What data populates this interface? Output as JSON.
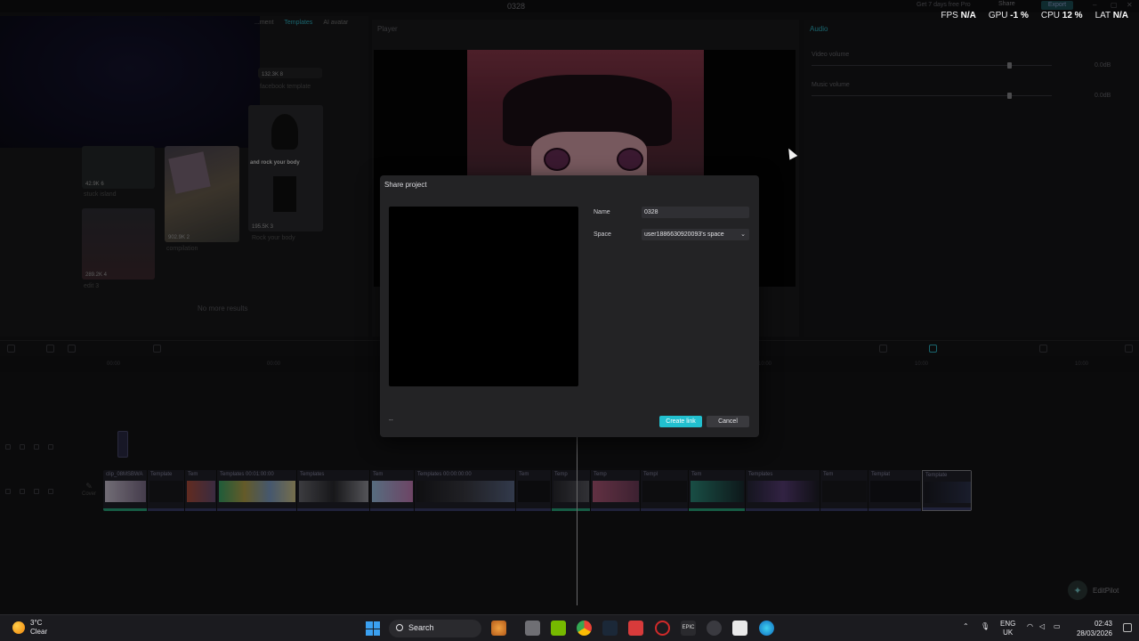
{
  "window": {
    "title": "0328",
    "promo": "Get 7 days free Pro",
    "share_label": "Share",
    "export_label": "Export"
  },
  "perf": [
    {
      "label": "FPS",
      "value": "N/A"
    },
    {
      "label": "GPU",
      "value": "-1 %"
    },
    {
      "label": "CPU",
      "value": "12 %"
    },
    {
      "label": "LAT",
      "value": "N/A"
    }
  ],
  "left_panel": {
    "tabs": [
      {
        "label": "...ment"
      },
      {
        "label": "Templates"
      },
      {
        "label": "AI avatar"
      }
    ],
    "tiles": [
      {
        "meta": "132.3K  8",
        "caption": "facebook template"
      },
      {
        "meta": "42.9K  6",
        "caption": "stuck island"
      },
      {
        "meta": "902.9K  2",
        "caption": "compilation"
      },
      {
        "meta": "195.5K  3",
        "caption": "Rock your body"
      },
      {
        "meta": "289.2K  4",
        "caption": "edit 3"
      }
    ],
    "rock_text": "and rock your body",
    "no_more": "No more results"
  },
  "player": {
    "title": "Player"
  },
  "audio": {
    "title": "Audio",
    "video_volume_label": "Video volume",
    "video_volume_value": "0.0dB",
    "music_volume_label": "Music volume",
    "music_volume_value": "0.0dB"
  },
  "timeline": {
    "ruler": [
      "00:00",
      "00:00",
      "10:00",
      "10:00",
      "10:00"
    ],
    "cover_label": "Cover",
    "clips": [
      {
        "label": "clip_08MSBWA"
      },
      {
        "label": "Template"
      },
      {
        "label": "Tem"
      },
      {
        "label": "Templates  00:01:00:00"
      },
      {
        "label": "Templates"
      },
      {
        "label": "Tem"
      },
      {
        "label": "Templates  00:00:00:00"
      },
      {
        "label": "Tem"
      },
      {
        "label": "Temp"
      },
      {
        "label": "Temp"
      },
      {
        "label": "Templ"
      },
      {
        "label": "Tem"
      },
      {
        "label": "Templates"
      },
      {
        "label": "Tem"
      },
      {
        "label": "Templat"
      },
      {
        "label": "Template"
      }
    ]
  },
  "editpilot": {
    "label": "EditPilot"
  },
  "dialog": {
    "title": "Share project",
    "name_label": "Name",
    "name_value": "0328",
    "space_label": "Space",
    "space_value": "user1886630920093's space",
    "dash": "--",
    "create_label": "Create link",
    "cancel_label": "Cancel"
  },
  "taskbar": {
    "weather_temp": "3°C",
    "weather_cond": "Clear",
    "search_label": "Search",
    "lang_top": "ENG",
    "lang_bottom": "UK",
    "time": "02:43",
    "date": "28/03/2026"
  }
}
